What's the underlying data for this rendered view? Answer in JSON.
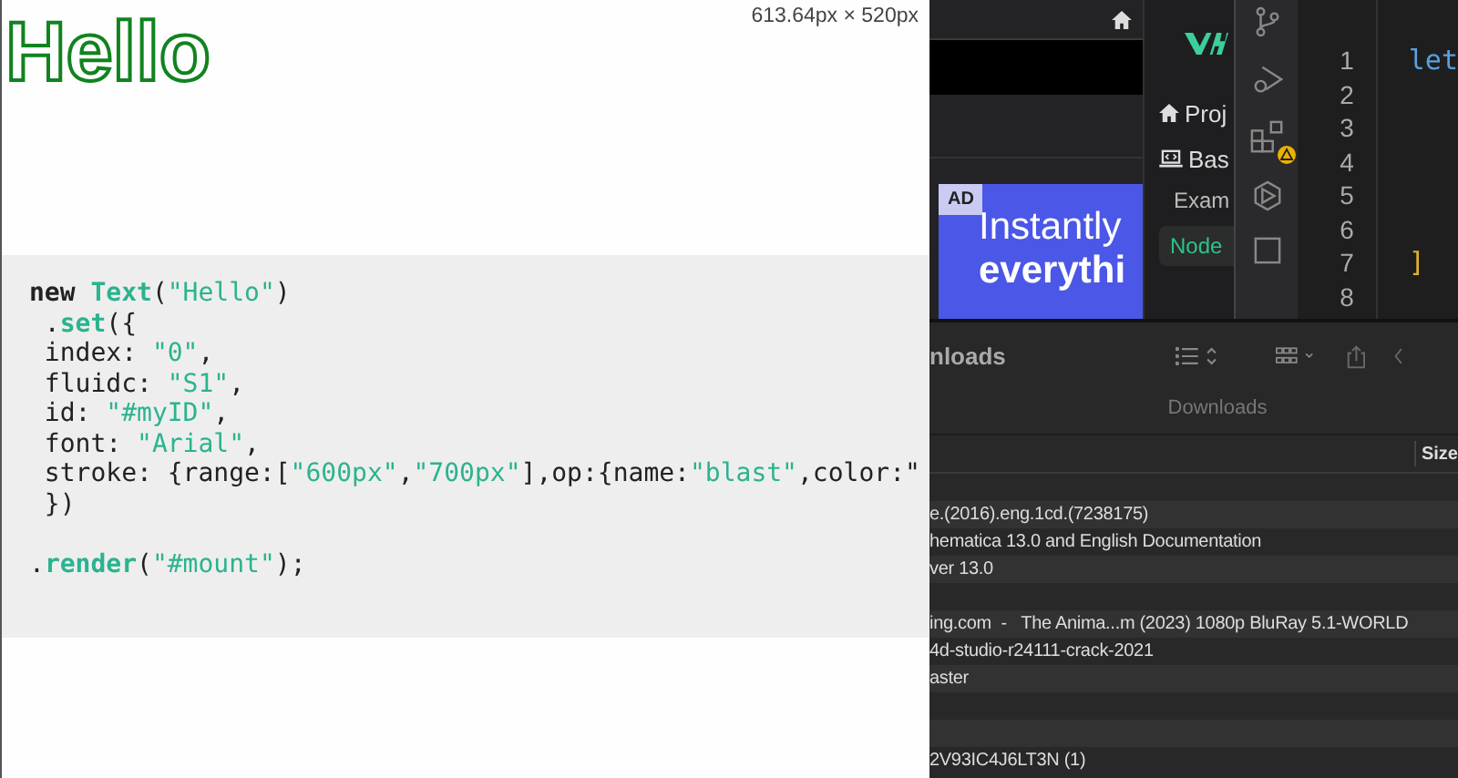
{
  "preview": {
    "heading": "Hello",
    "dimensions": "613.64px × 520px"
  },
  "code": {
    "lines": [
      [
        {
          "kind": "keyword",
          "text": "new "
        },
        {
          "kind": "name",
          "text": "Text"
        },
        {
          "kind": "plain",
          "text": "("
        },
        {
          "kind": "string",
          "text": "\"Hello\""
        },
        {
          "kind": "plain",
          "text": ")"
        }
      ],
      [
        {
          "kind": "plain",
          "text": " ."
        },
        {
          "kind": "name",
          "text": "set"
        },
        {
          "kind": "plain",
          "text": "({"
        }
      ],
      [
        {
          "kind": "plain",
          "text": " index: "
        },
        {
          "kind": "string",
          "text": "\"0\""
        },
        {
          "kind": "plain",
          "text": ","
        }
      ],
      [
        {
          "kind": "plain",
          "text": " fluidc: "
        },
        {
          "kind": "string",
          "text": "\"S1\""
        },
        {
          "kind": "plain",
          "text": ","
        }
      ],
      [
        {
          "kind": "plain",
          "text": " id: "
        },
        {
          "kind": "string",
          "text": "\"#myID\""
        },
        {
          "kind": "plain",
          "text": ","
        }
      ],
      [
        {
          "kind": "plain",
          "text": " font: "
        },
        {
          "kind": "string",
          "text": "\"Arial\""
        },
        {
          "kind": "plain",
          "text": ","
        }
      ],
      [
        {
          "kind": "plain",
          "text": " stroke: {range:["
        },
        {
          "kind": "string",
          "text": "\"600px\""
        },
        {
          "kind": "plain",
          "text": ","
        },
        {
          "kind": "string",
          "text": "\"700px\""
        },
        {
          "kind": "plain",
          "text": "],op:{name:"
        },
        {
          "kind": "string",
          "text": "\"blast\""
        },
        {
          "kind": "plain",
          "text": ",color:\""
        }
      ],
      [
        {
          "kind": "plain",
          "text": " })"
        }
      ],
      [
        {
          "kind": "plain",
          "text": "."
        },
        {
          "kind": "name",
          "text": "render"
        },
        {
          "kind": "plain",
          "text": "("
        },
        {
          "kind": "string",
          "text": "\"#mount\""
        },
        {
          "kind": "plain",
          "text": ");"
        }
      ]
    ]
  },
  "ad": {
    "badge": "AD",
    "line_1": "Instantly",
    "line_2": "everythi"
  },
  "sidebar": {
    "items": [
      {
        "kind": "home",
        "label": "Proj",
        "selected": false
      },
      {
        "kind": "code",
        "label": "Bas",
        "selected": false
      },
      {
        "kind": "heading",
        "label": "Exam",
        "selected": false
      },
      {
        "kind": "chip",
        "label": "Node",
        "selected": true
      }
    ]
  },
  "editor": {
    "line_numbers": [
      "1",
      "2",
      "3",
      "4",
      "5",
      "6",
      "7",
      "8"
    ],
    "line_1": "let",
    "line_7": "]"
  },
  "finder": {
    "title": "nloads",
    "subtitle": "Downloads",
    "columns": [
      "Size"
    ],
    "rows": [
      "",
      "e.(2016).eng.1cd.(7238175)",
      "hematica 13.0 and English Documentation",
      "ver 13.0",
      "",
      "ing.com  -   The Anima...m (2023) 1080p BluRay 5.1-WORLD",
      "4d-studio-r24111-crack-2021",
      "aster",
      "",
      "",
      "2V93IC4J6LT3N (1)"
    ]
  }
}
